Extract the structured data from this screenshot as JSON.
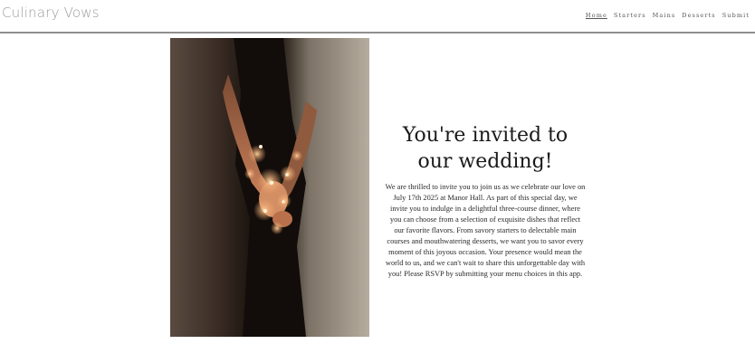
{
  "app": {
    "title": "Culinary Vows"
  },
  "nav": {
    "items": [
      "Home",
      "Starters",
      "Mains",
      "Desserts",
      "Submit"
    ],
    "active": "Home"
  },
  "hero": {
    "heading_line1": "You're invited to",
    "heading_line2": "our wedding!",
    "body": "We are thrilled to invite you to join us as we celebrate our love on July 17th 2025 at Manor Hall. As part of this special day, we invite you to indulge in a delightful three-course dinner, where you can choose from a selection of exquisite dishes that reflect our favorite flavors. From savory starters to delectable main courses and mouthwatering desserts, we want you to savor every moment of this joyous occasion. Your presence would mean the world to us, and we can't wait to share this unforgettable day with you! Please RSVP by submitting your menu choices in this app.",
    "image": "couple-holding-hands-with-string-lights"
  },
  "colors": {
    "brand_text": "#9a9a9a",
    "header_rule": "#8f8f8f",
    "photo_dark": "#17110d",
    "warm_light": "#f3b27a"
  }
}
